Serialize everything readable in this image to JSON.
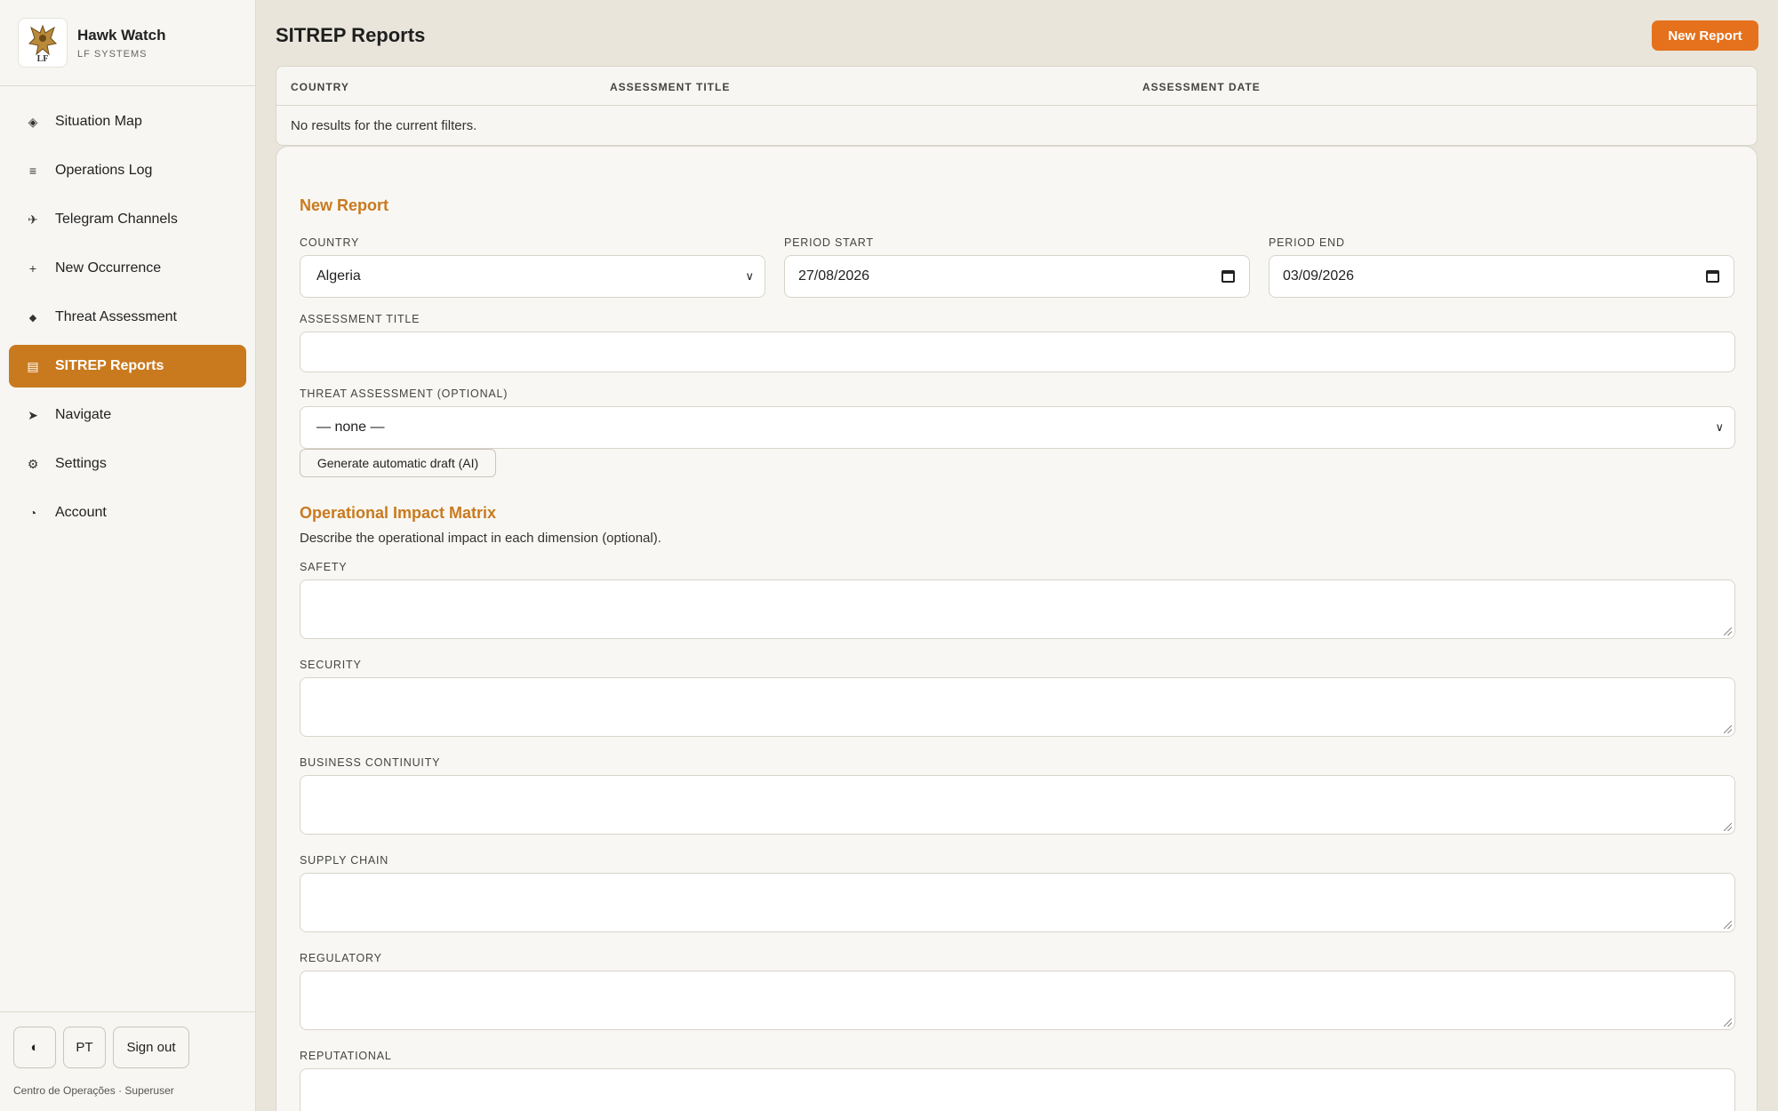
{
  "brand": {
    "title": "Hawk Watch",
    "subtitle": "LF SYSTEMS",
    "logo_icon": "hawk-crest-logo"
  },
  "sidebar": {
    "items": [
      {
        "label": "Situation Map",
        "icon": "diamond-map-icon",
        "glyph": "◈",
        "active": false
      },
      {
        "label": "Operations Log",
        "icon": "list-icon",
        "glyph": "≡",
        "active": false
      },
      {
        "label": "Telegram Channels",
        "icon": "plane-icon",
        "glyph": "✈",
        "active": false
      },
      {
        "label": "New Occurrence",
        "icon": "plus-icon",
        "glyph": "+",
        "active": false
      },
      {
        "label": "Threat Assessment",
        "icon": "diamond-icon",
        "glyph": "◆",
        "active": false
      },
      {
        "label": "SITREP Reports",
        "icon": "report-icon",
        "glyph": "▤",
        "active": true
      },
      {
        "label": "Navigate",
        "icon": "arrow-icon",
        "glyph": "➤",
        "active": false
      },
      {
        "label": "Settings",
        "icon": "gear-icon",
        "glyph": "⚙",
        "active": false
      },
      {
        "label": "Account",
        "icon": "account-icon",
        "glyph": "◔",
        "active": false
      }
    ],
    "theme_toggle_glyph": "◐",
    "lang_label": "PT",
    "signout_label": "Sign out",
    "footer": "Centro de Operações · Superuser"
  },
  "header": {
    "title": "SITREP Reports",
    "new_report_label": "New Report"
  },
  "table": {
    "columns": [
      "COUNTRY",
      "ASSESSMENT TITLE",
      "ASSESSMENT DATE"
    ],
    "empty_message": "No results for the current filters."
  },
  "form": {
    "title": "New Report",
    "country_label": "COUNTRY",
    "country_value": "Algeria",
    "period_start_label": "PERIOD START",
    "period_start_value": "27/08/2026",
    "period_end_label": "PERIOD END",
    "period_end_value": "03/09/2026",
    "assessment_title_label": "ASSESSMENT TITLE",
    "assessment_title_value": "",
    "threat_label": "THREAT ASSESSMENT (OPTIONAL)",
    "threat_value": "— none —",
    "ai_button_label": "Generate automatic draft (AI)",
    "matrix_title": "Operational Impact Matrix",
    "matrix_desc": "Describe the operational impact in each dimension (optional).",
    "dimensions": [
      "SAFETY",
      "SECURITY",
      "BUSINESS CONTINUITY",
      "SUPPLY CHAIN",
      "REGULATORY",
      "REPUTATIONAL"
    ]
  },
  "colors": {
    "accent": "#c97a1f",
    "primary_button": "#e5711c",
    "background": "#e9e5db"
  }
}
